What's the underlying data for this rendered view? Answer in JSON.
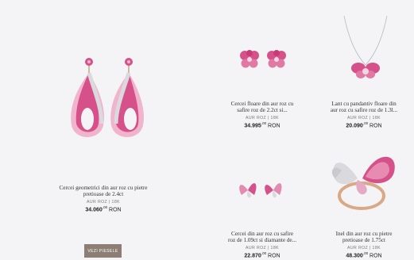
{
  "products": [
    {
      "title_lines": [
        "Cercei geometrici din aur roz cu pietre",
        "pretioase de 2.4ct"
      ],
      "meta": "AUR ROZ | 18K",
      "price_main": "34.060",
      "price_cents": "00",
      "currency": "RON"
    },
    {
      "title_lines": [
        "Cercei floare din aur roz cu",
        "safire roz de 2.2ct si..."
      ],
      "meta": "AUR ROZ | 18K",
      "price_main": "34.995",
      "price_cents": "00",
      "currency": "RON"
    },
    {
      "title_lines": [
        "Lant cu pandantiv floare din",
        "aur roz cu safire roz de 1.3l..."
      ],
      "meta": "AUR ROZ | 18K",
      "price_main": "20.090",
      "price_cents": "00",
      "currency": "RON"
    },
    {
      "title_lines": [
        "Cercei din aur roz cu safire",
        "roz de 1.09ct si diamante de..."
      ],
      "meta": "AUR ROZ | 18K",
      "price_main": "22.870",
      "price_cents": "00",
      "currency": "RON"
    },
    {
      "title_lines": [
        "Inel din aur roz cu pietre",
        "pretioase de 1.75ct"
      ],
      "meta": "AUR ROZ | 18K",
      "price_main": "48.300",
      "price_cents": "00",
      "currency": "RON"
    }
  ],
  "cta": {
    "label": "VEZI PIESELE"
  },
  "colors": {
    "accent_pink": "#d6508a",
    "light_pink": "#f0b5cc",
    "diamond": "#d9d9de",
    "button_bg": "#8c7e74"
  },
  "icons": [
    "drop-earrings",
    "flower-stud-earrings",
    "orchid-pendant-necklace",
    "butterfly-stud-earrings",
    "butterfly-ring"
  ]
}
